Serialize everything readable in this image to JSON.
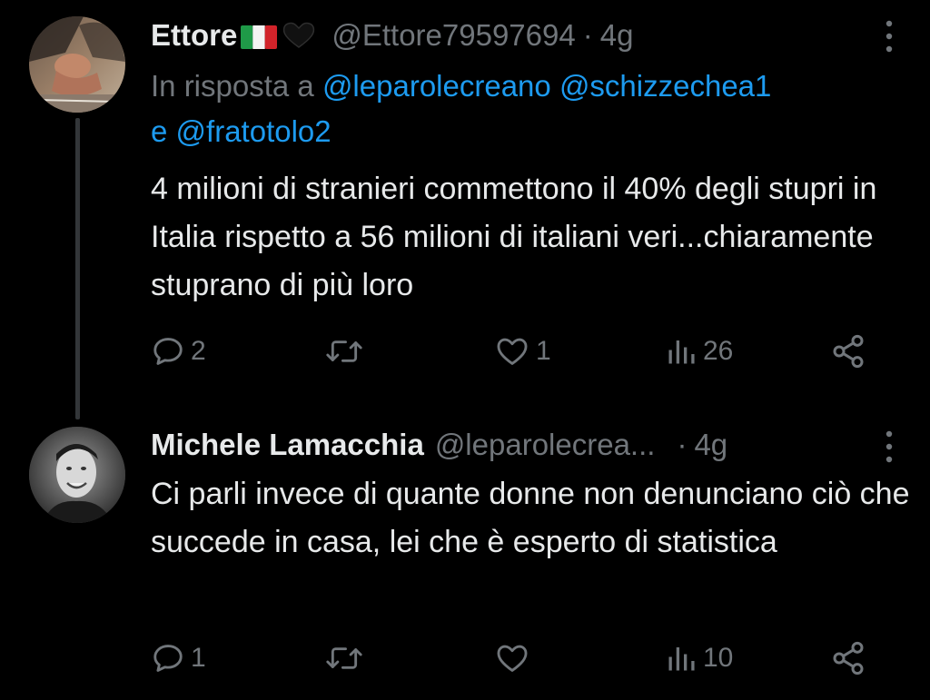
{
  "tweets": [
    {
      "author_name": "Ettore",
      "handle": "@Ettore79597694",
      "separator": "·",
      "time": "4g",
      "flag_icon": "italy-flag-icon",
      "reply_prefix": "In risposta a",
      "reply_mentions": [
        "@leparolecreano",
        "@schizzechea1"
      ],
      "reply_joiner": "e",
      "reply_last": "@fratotolo2",
      "text": "4 milioni di stranieri commettono il 40% degli stupri in Italia rispetto a 56 milioni di italiani veri...chiaramente stuprano di più loro",
      "stats": {
        "replies": "2",
        "retweets": "",
        "likes": "1",
        "views": "26"
      }
    },
    {
      "author_name": "Michele Lamacchia",
      "handle": "@leparolecrea...",
      "separator": "·",
      "time": "4g",
      "text": "Ci parli invece di quante donne non denunciano ciò che succede in casa, lei che è esperto di statistica",
      "stats": {
        "replies": "1",
        "retweets": "",
        "likes": "",
        "views": "10"
      }
    }
  ],
  "colors": {
    "background": "#000000",
    "text": "#e7e9ea",
    "muted": "#71767b",
    "link": "#1d9bf0",
    "thread_line": "#333639"
  }
}
